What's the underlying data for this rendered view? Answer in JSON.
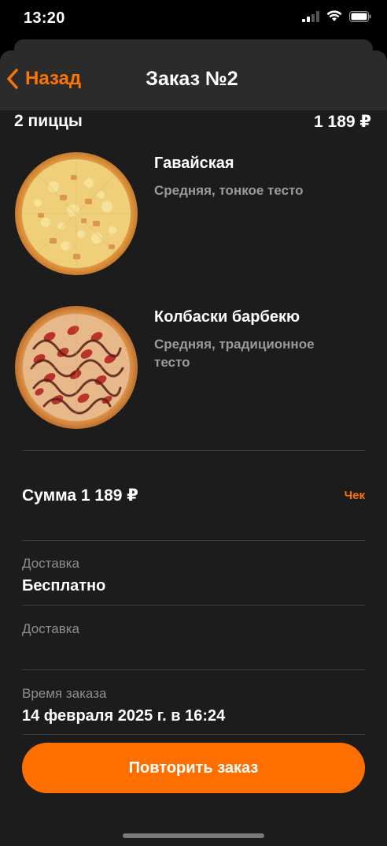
{
  "status_bar": {
    "time": "13:20",
    "icons": [
      "cellular-signal-icon",
      "wifi-icon",
      "battery-icon"
    ]
  },
  "nav": {
    "back_label": "Назад",
    "back_icon": "chevron-left-icon",
    "title": "Заказ №2"
  },
  "summary": {
    "count_label": "2 пиццы",
    "total": "1 189 ₽"
  },
  "items": [
    {
      "name": "Гавайская",
      "description": "Средняя, тонкое тесто",
      "image": "hawaiian-pizza-image"
    },
    {
      "name": "Колбаски барбекю",
      "description": "Средняя, традиционное тесто",
      "image": "bbq-sausage-pizza-image"
    }
  ],
  "sum": {
    "label": "Сумма 1 189 ₽",
    "receipt_link": "Чек"
  },
  "fields": [
    {
      "label": "Доставка",
      "value": "Бесплатно"
    },
    {
      "label": "Доставка",
      "value": ""
    },
    {
      "label": "Время заказа",
      "value": "14 февраля 2025 г. в 16:24"
    }
  ],
  "actions": {
    "repeat_label": "Повторить заказ"
  },
  "colors": {
    "accent": "#ff7300",
    "background": "#1c1c1c",
    "nav_background": "#2b2b2b",
    "secondary_text": "#8e8e8e"
  }
}
